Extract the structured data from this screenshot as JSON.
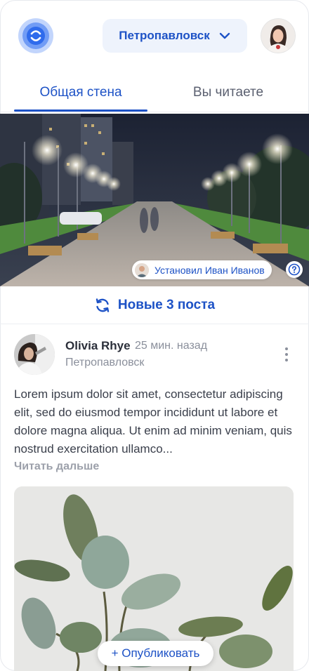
{
  "header": {
    "city": "Петропавловск",
    "logo_icon": "logo-icon",
    "chevron_icon": "chevron-down-icon",
    "accent_color": "#1d52c6"
  },
  "tabs": [
    {
      "label": "Общая стена",
      "active": true
    },
    {
      "label": "Вы читаете",
      "active": false
    }
  ],
  "cover": {
    "installed_by": "Установил Иван Иванов",
    "help_icon": "question-circle-icon"
  },
  "new_posts": {
    "label": "Новые 3 поста",
    "icon": "refresh-icon"
  },
  "post": {
    "author": "Olivia Rhye",
    "time": "25 мин. назад",
    "city": "Петропавловск",
    "text": "Lorem ipsum dolor sit amet, consectetur adipiscing elit, sed do eiusmod tempor incididunt ut labore et dolore magna aliqua. Ut enim ad minim veniam, quis nostrud exercitation ullamco...",
    "read_more": "Читать дальше",
    "menu_icon": "more-vertical-icon"
  },
  "publish_button": {
    "label": "+ Опубликовать"
  }
}
